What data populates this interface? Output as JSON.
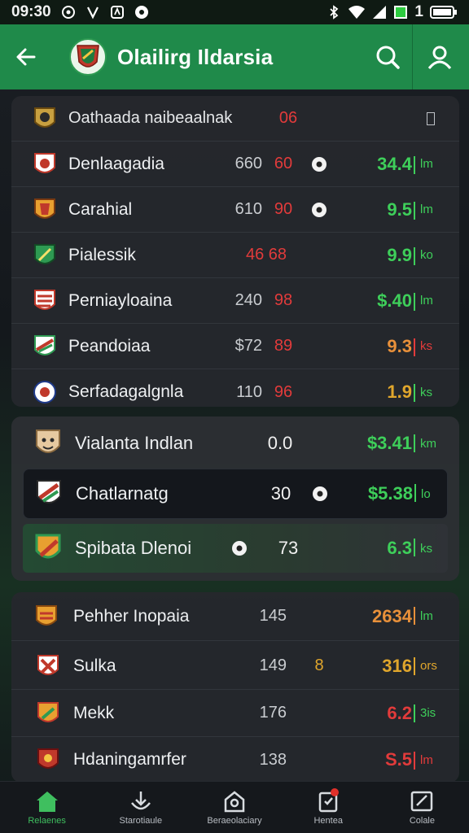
{
  "status_bar": {
    "time": "09:30",
    "battery": "1"
  },
  "app_bar": {
    "title": "Olailirg Ildarsia"
  },
  "colors": {
    "brand": "#1f8a4a",
    "green": "#3ecf5a",
    "red": "#e23b3b",
    "orange": "#e89a3a",
    "yellow": "#e0a62c"
  },
  "card1": {
    "header": {
      "name": "Oathaada naibeaalnak",
      "c2": "06"
    },
    "rows": [
      {
        "name": "Denlaagadia",
        "c1": "660",
        "c2": "60",
        "score": "34.4",
        "unit": "lm",
        "score_color": "green",
        "ball": true
      },
      {
        "name": "Carahial",
        "c1": "610",
        "c2": "90",
        "score": "9.5",
        "unit": "lm",
        "score_color": "green",
        "ball": true
      },
      {
        "name": "Pialessik",
        "c1": "",
        "c2": "46  68",
        "score": "9.9",
        "unit": "ko",
        "score_color": "green",
        "ball": false
      },
      {
        "name": "Perniayloaina",
        "c1": "240",
        "c2": "98",
        "score": "$.40",
        "unit": "lm",
        "score_color": "green",
        "ball": false
      },
      {
        "name": "Peandoiaa",
        "c1": "$72",
        "c2": "89",
        "score": "9.3",
        "unit": "ks",
        "score_color": "orange",
        "ball": false
      },
      {
        "name": "Serfadagalgnla",
        "c1": "110",
        "c2": "96",
        "score": "1.9",
        "unit": "ks",
        "score_color": "yellow",
        "ball": false
      }
    ]
  },
  "card2": {
    "rows": [
      {
        "name": "Vialanta  Indlan",
        "c1": "0.0",
        "score": "$3.41",
        "unit": "km",
        "score_color": "green"
      },
      {
        "name": "Chatlarnatg",
        "c1": "30",
        "score": "$5.38",
        "unit": "lo",
        "score_color": "green"
      },
      {
        "name": "Spibata Dlenoi",
        "c1": "73",
        "score": "6.3",
        "unit": "ks",
        "score_color": "green"
      }
    ]
  },
  "card3": {
    "rows": [
      {
        "name": "Pehher Inopaia",
        "c1": "145",
        "c2": "",
        "score": "2634",
        "unit": "lm",
        "score_color": "orange"
      },
      {
        "name": "Sulka",
        "c1": "149",
        "c2": "8",
        "score": "316",
        "unit": "ors",
        "score_color": "orange"
      },
      {
        "name": "Mekk",
        "c1": "176",
        "c2": "",
        "score": "6.2",
        "unit": "3is",
        "score_color": "red"
      },
      {
        "name": "Hdaningamrfer",
        "c1": "138",
        "c2": "",
        "score": "S.5",
        "unit": "lm",
        "score_color": "red"
      }
    ]
  },
  "bottom_nav": {
    "items": [
      {
        "label": "Relaenes",
        "icon": "home-icon"
      },
      {
        "label": "Starotiaule",
        "icon": "joystick-icon"
      },
      {
        "label": "Beraeolaciary",
        "icon": "home-outline-icon"
      },
      {
        "label": "Hentea",
        "icon": "notification-icon"
      },
      {
        "label": "Colale",
        "icon": "edit-icon"
      }
    ]
  }
}
